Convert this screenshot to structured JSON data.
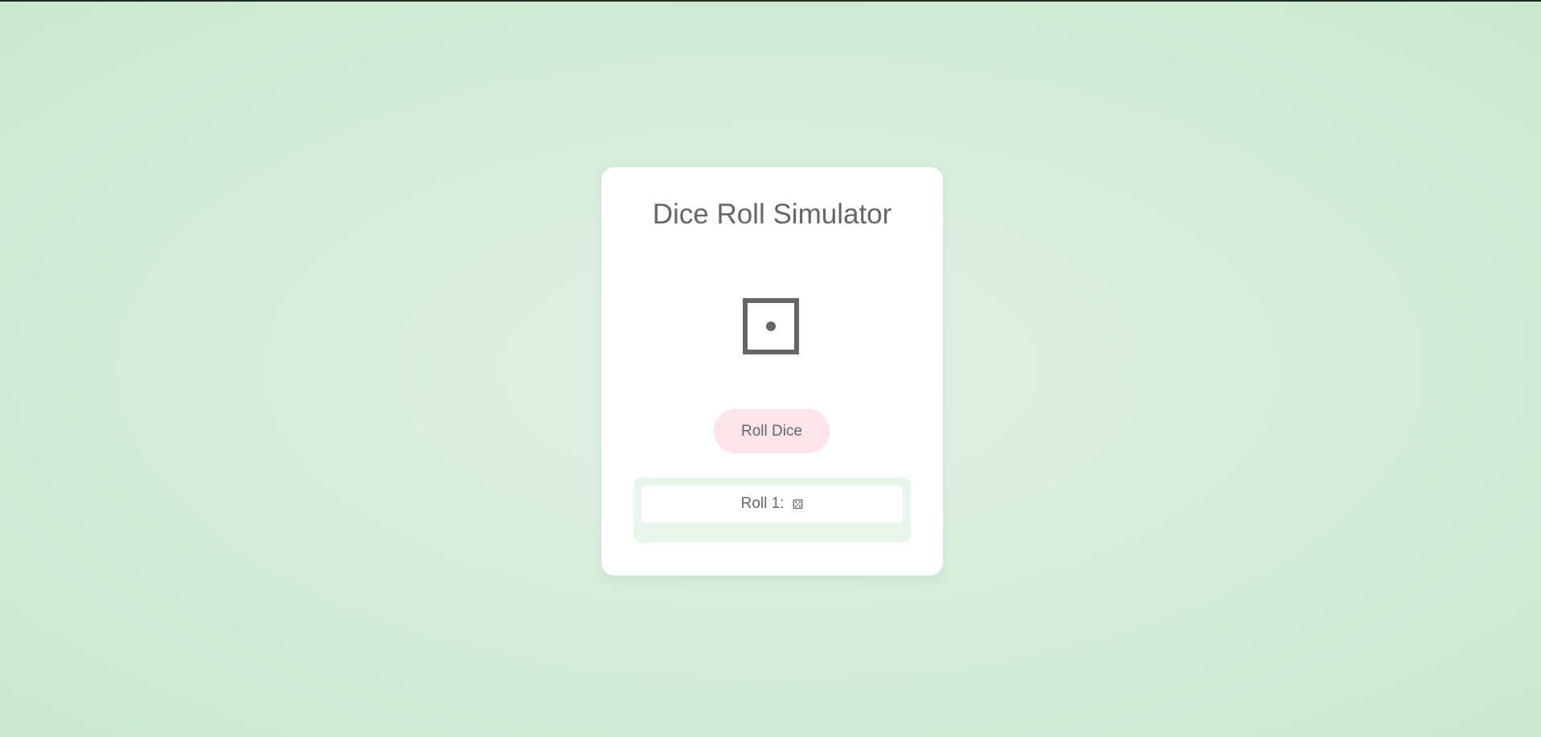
{
  "app": {
    "title": "Dice Roll Simulator"
  },
  "die": {
    "value": 1,
    "icon": "die-face-1-icon"
  },
  "controls": {
    "roll_label": "Roll Dice"
  },
  "history": [
    {
      "label": "Roll 1:",
      "face": "⚄"
    }
  ],
  "colors": {
    "text": "#666666",
    "button_bg": "#fce4ea",
    "history_bg": "#e8f5ea",
    "card_bg": "#ffffff"
  }
}
